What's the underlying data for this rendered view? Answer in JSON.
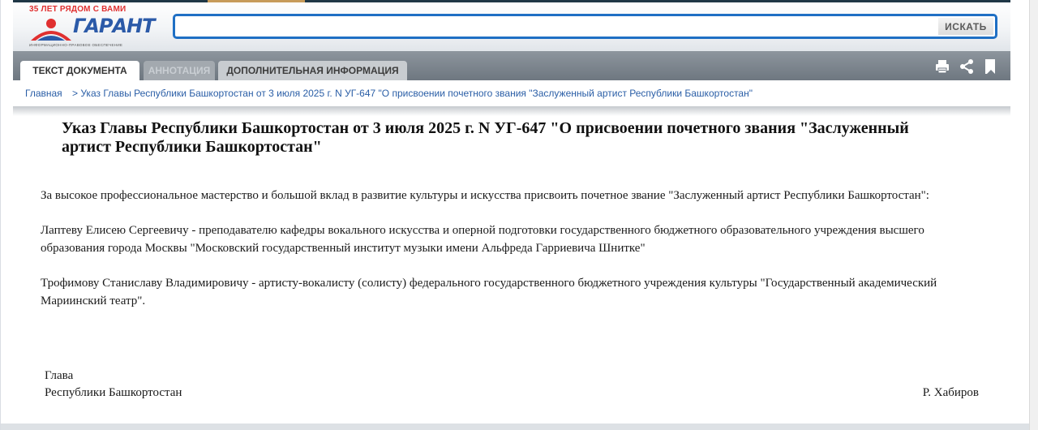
{
  "header": {
    "logo_tagline": "35 ЛЕТ РЯДОМ С ВАМИ",
    "logo_word": "ГАРАНТ",
    "logo_subtitle": "ИНФОРМАЦИОННО-ПРАВОВОЕ ОБЕСПЕЧЕНИЕ",
    "search": {
      "value": "",
      "placeholder": "",
      "button_label": "ИСКАТЬ"
    }
  },
  "tabs": [
    {
      "label": "ТЕКСТ ДОКУМЕНТА",
      "state": "active"
    },
    {
      "label": "АННОТАЦИЯ",
      "state": "disabled"
    },
    {
      "label": "ДОПОЛНИТЕЛЬНАЯ ИНФОРМАЦИЯ",
      "state": "normal"
    }
  ],
  "toolbar": {
    "icons": [
      "print-icon",
      "share-icon",
      "bookmark-icon"
    ]
  },
  "breadcrumb": {
    "home": "Главная",
    "current": "> Указ Главы Республики Башкортостан от 3 июля 2025 г. N УГ-647 \"О присвоении почетного звания \"Заслуженный артист Республики Башкортостан\""
  },
  "document": {
    "title": "Указ Главы Республики Башкортостан от 3 июля 2025 г. N УГ-647 \"О присвоении почетного звания \"Заслуженный артист Республики Башкортостан\"",
    "paragraphs": [
      "За высокое профессиональное мастерство и большой вклад в развитие культуры и искусства присвоить почетное звание \"Заслуженный артист Республики Башкортостан\":",
      "Лаптеву Елисею Сергеевичу - преподавателю кафедры вокального искусства и оперной подготовки государственного бюджетного образовательного учреждения высшего образования города Москвы \"Московский государственный институт музыки имени Альфреда Гарриевича Шнитке\"",
      "Трофимову Станиславу Владимировичу - артисту-вокалисту (солисту) федерального государственного бюджетного учреждения культуры \"Государственный академический Мариинский театр\"."
    ],
    "signature": {
      "position_line1": "Глава",
      "position_line2": "Республики Башкортостан",
      "name": "Р. Хабиров"
    }
  },
  "colors": {
    "accent": "#1f6fc4",
    "link": "#2a5ea6",
    "tabbar": "#7a828a",
    "logo_red": "#e03030",
    "logo_blue": "#2b5aa8"
  }
}
